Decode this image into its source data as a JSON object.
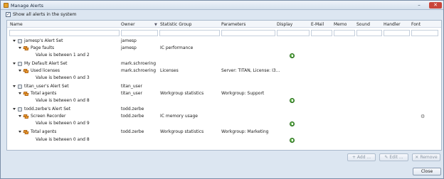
{
  "window": {
    "title": "Manage Alerts",
    "min_glyph": "–",
    "close_glyph": "✕"
  },
  "show_all": {
    "label": "Show all alerts in the system",
    "checked": true,
    "check_glyph": "✓"
  },
  "columns": {
    "name": "Name",
    "owner": "Owner",
    "statistic_group": "Statistic Group",
    "parameters": "Parameters",
    "display": "Display",
    "email": "E-Mail",
    "memo": "Memo",
    "sound": "Sound",
    "handler": "Handler",
    "font": "Font",
    "sort_glyph": "▼"
  },
  "rows": [
    {
      "name": "jamesp's Alert Set",
      "owner": "jamesp",
      "statistic_group": "",
      "parameters": ""
    },
    {
      "name": "Page faults",
      "owner": "jamesp",
      "statistic_group": "IC performance",
      "parameters": ""
    },
    {
      "name": "Value is between 1 and 2",
      "owner": "",
      "statistic_group": "",
      "parameters": ""
    },
    {
      "name": "My Default Alert Set",
      "owner": "mark.schroering",
      "statistic_group": "",
      "parameters": ""
    },
    {
      "name": "Used licenses",
      "owner": "mark.schroering",
      "statistic_group": "Licenses",
      "parameters": "Server: TITAN, License: I3..."
    },
    {
      "name": "Value is between 0 and 3",
      "owner": "",
      "statistic_group": "",
      "parameters": ""
    },
    {
      "name": "titan_user's Alert Set",
      "owner": "titan_user",
      "statistic_group": "",
      "parameters": ""
    },
    {
      "name": "Total agents",
      "owner": "titan_user",
      "statistic_group": "Workgroup statistics",
      "parameters": "Workgroup: Support"
    },
    {
      "name": "Value is between 0 and 8",
      "owner": "",
      "statistic_group": "",
      "parameters": ""
    },
    {
      "name": "todd.zerbe's Alert Set",
      "owner": "todd.zerbe",
      "statistic_group": "",
      "parameters": ""
    },
    {
      "name": "Screen Recorder",
      "owner": "todd.zerbe",
      "statistic_group": "IC memory usage",
      "parameters": ""
    },
    {
      "name": "Value is between 0 and 9",
      "owner": "",
      "statistic_group": "",
      "parameters": ""
    },
    {
      "name": "Total agents",
      "owner": "todd.zerbe",
      "statistic_group": "Workgroup statistics",
      "parameters": "Workgroup: Marketing"
    },
    {
      "name": "Value is between 0 and 8",
      "owner": "",
      "statistic_group": "",
      "parameters": ""
    }
  ],
  "icons": {
    "display_indicator": "green-circle",
    "font_indicator": "font-settings"
  },
  "font_glyph": "⚙",
  "buttons": {
    "add": "Add ...",
    "edit": "Edit ...",
    "remove": "Remove",
    "close": "Close",
    "add_glyph": "+",
    "edit_glyph": "✎",
    "remove_glyph": "✕"
  },
  "colors": {
    "window_bg": "#dce6f1",
    "display_indicator": "#2e8a22"
  }
}
